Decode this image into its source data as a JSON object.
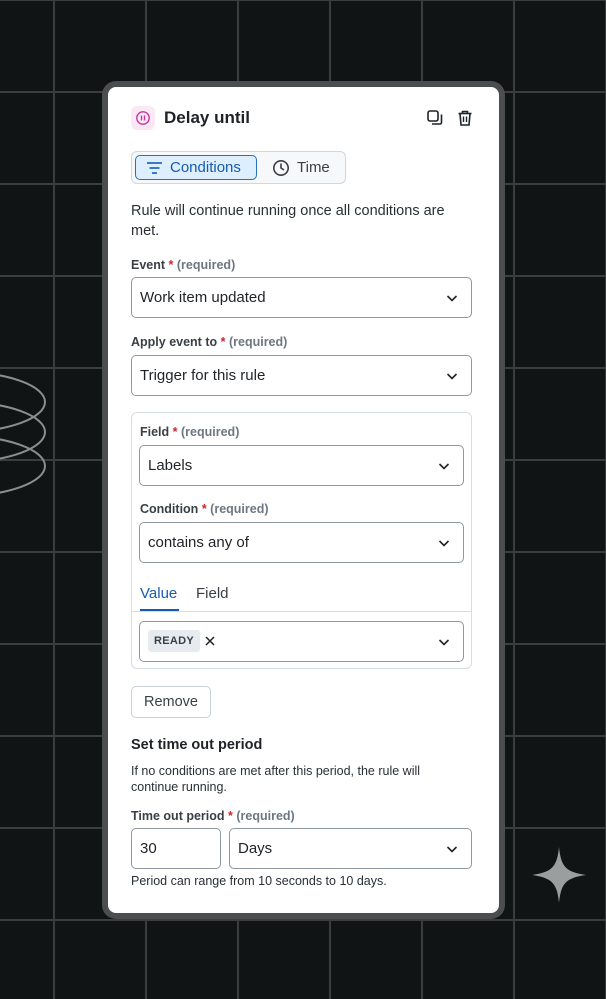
{
  "panel": {
    "title": "Delay until",
    "icon": "pause-circle-icon",
    "actions": [
      "duplicate-icon",
      "trash-icon"
    ]
  },
  "segmented": {
    "conditions_label": "Conditions",
    "time_label": "Time",
    "active": "Conditions"
  },
  "description": "Rule will continue running once all conditions are met.",
  "event": {
    "label": "Event",
    "required": "(required)",
    "value": "Work item updated"
  },
  "apply_event": {
    "label": "Apply event to",
    "required": "(required)",
    "value": "Trigger for this rule"
  },
  "condition_block": {
    "field": {
      "label": "Field",
      "required": "(required)",
      "value": "Labels"
    },
    "condition": {
      "label": "Condition",
      "required": "(required)",
      "value": "contains any of"
    },
    "tabs": {
      "value_label": "Value",
      "field_label": "Field",
      "active": "Value"
    },
    "chip_value": "READY"
  },
  "remove_label": "Remove",
  "timeout": {
    "title": "Set time out period",
    "description": "If no conditions are met after this period, the rule will continue running.",
    "label": "Time out period",
    "required": "(required)",
    "amount": "30",
    "unit": "Days",
    "helper": "Period can range from 10 seconds to 10 days."
  },
  "colors": {
    "background": "#101414",
    "accent": "#175bb0",
    "required_star": "#d1242f",
    "icon_pink": "#c0399e"
  }
}
